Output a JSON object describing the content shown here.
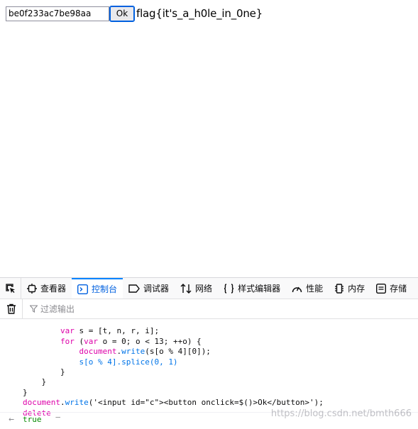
{
  "page": {
    "input_value": "be0f233ac7be98aa",
    "ok_button": "Ok",
    "flag_text": "flag{it's_a_h0le_in_0ne}"
  },
  "devtools": {
    "tabs": [
      {
        "label": "查看器",
        "icon": "inspector-icon"
      },
      {
        "label": "控制台",
        "icon": "console-icon"
      },
      {
        "label": "调试器",
        "icon": "debugger-icon"
      },
      {
        "label": "网络",
        "icon": "network-icon"
      },
      {
        "label": "样式编辑器",
        "icon": "style-editor-icon"
      },
      {
        "label": "性能",
        "icon": "performance-icon"
      },
      {
        "label": "内存",
        "icon": "memory-icon"
      },
      {
        "label": "存储",
        "icon": "storage-icon"
      }
    ],
    "active_tab": "控制台",
    "filter_placeholder": "过滤输出",
    "result": "true",
    "watermark": "https://blog.csdn.net/bmth666"
  },
  "console_lines": [
    {
      "indent": "",
      "parts": [
        {
          "t": "",
          "c": ""
        }
      ]
    },
    {
      "indent": "        ",
      "parts": [
        {
          "t": "var",
          "c": "kw"
        },
        {
          "t": " s = [t, n, r, i];",
          "c": ""
        }
      ]
    },
    {
      "indent": "        ",
      "parts": [
        {
          "t": "for",
          "c": "kw"
        },
        {
          "t": " (",
          "c": ""
        },
        {
          "t": "var",
          "c": "kw"
        },
        {
          "t": " o = 0; o < 13; ++o) {",
          "c": ""
        }
      ]
    },
    {
      "indent": "            ",
      "parts": [
        {
          "t": "document",
          "c": "kw"
        },
        {
          "t": ".",
          "c": ""
        },
        {
          "t": "write",
          "c": "fn"
        },
        {
          "t": "(s[o % 4][0]);",
          "c": ""
        }
      ]
    },
    {
      "indent": "            ",
      "parts": [
        {
          "t": "s[o % 4].splice(0, 1)",
          "c": "fn"
        }
      ]
    },
    {
      "indent": "        ",
      "parts": [
        {
          "t": "}",
          "c": ""
        }
      ]
    },
    {
      "indent": "    ",
      "parts": [
        {
          "t": "}",
          "c": ""
        }
      ]
    },
    {
      "indent": "",
      "parts": [
        {
          "t": "}",
          "c": ""
        }
      ]
    },
    {
      "indent": "",
      "parts": [
        {
          "t": "document",
          "c": "kw"
        },
        {
          "t": ".",
          "c": ""
        },
        {
          "t": "write",
          "c": "fn"
        },
        {
          "t": "('<input id=\"c\"><button onclick=$()>Ok</button>');",
          "c": ""
        }
      ]
    },
    {
      "indent": "",
      "parts": [
        {
          "t": "delete",
          "c": "kw"
        },
        {
          "t": " _",
          "c": ""
        }
      ]
    }
  ]
}
